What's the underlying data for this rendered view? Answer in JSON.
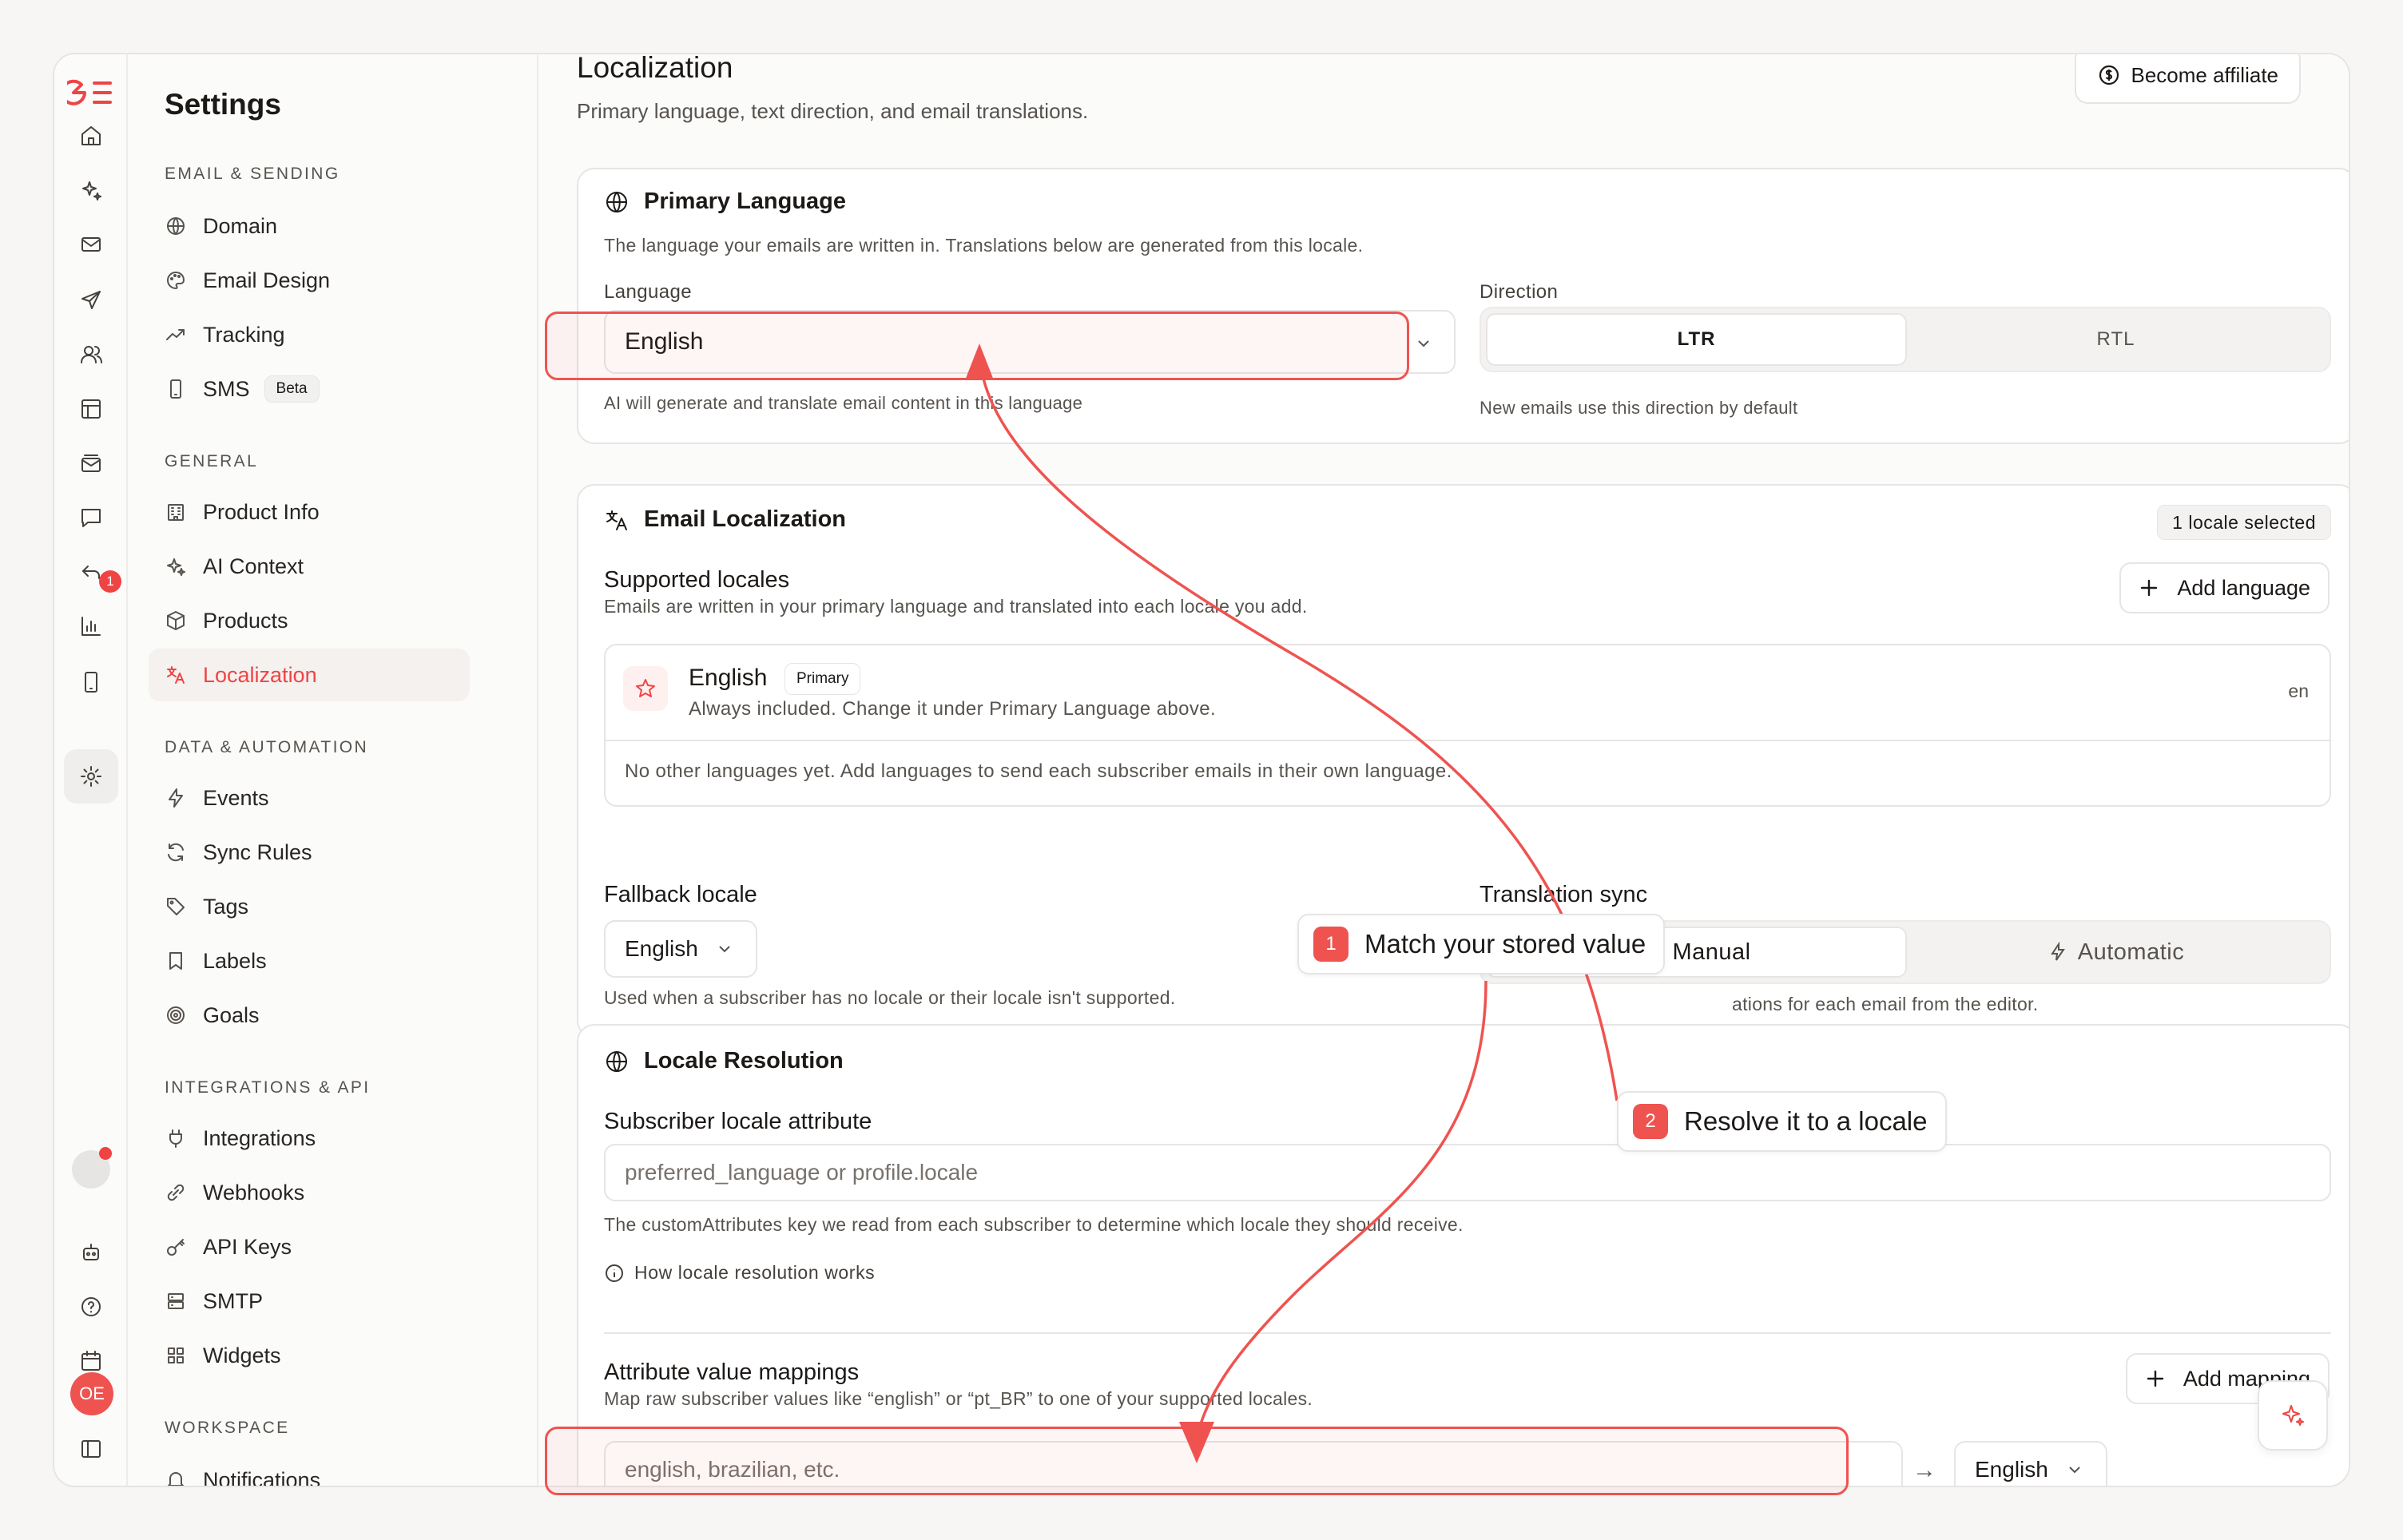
{
  "nav": {
    "title": "Settings",
    "sections": [
      {
        "label": "EMAIL & SENDING",
        "items": [
          {
            "label": "Domain",
            "icon": "globe-icon"
          },
          {
            "label": "Email Design",
            "icon": "palette-icon"
          },
          {
            "label": "Tracking",
            "icon": "trending-icon"
          },
          {
            "label": "SMS",
            "icon": "phone-icon",
            "badge": "Beta"
          }
        ]
      },
      {
        "label": "GENERAL",
        "items": [
          {
            "label": "Product Info",
            "icon": "building-icon"
          },
          {
            "label": "AI Context",
            "icon": "sparkles-icon"
          },
          {
            "label": "Products",
            "icon": "box-icon"
          },
          {
            "label": "Localization",
            "icon": "translate-icon",
            "active": true
          }
        ]
      },
      {
        "label": "DATA & AUTOMATION",
        "items": [
          {
            "label": "Events",
            "icon": "bolt-icon"
          },
          {
            "label": "Sync Rules",
            "icon": "refresh-icon"
          },
          {
            "label": "Tags",
            "icon": "tag-icon"
          },
          {
            "label": "Labels",
            "icon": "bookmark-icon"
          },
          {
            "label": "Goals",
            "icon": "target-icon"
          }
        ]
      },
      {
        "label": "INTEGRATIONS & API",
        "items": [
          {
            "label": "Integrations",
            "icon": "plug-icon"
          },
          {
            "label": "Webhooks",
            "icon": "link-icon"
          },
          {
            "label": "API Keys",
            "icon": "key-icon"
          },
          {
            "label": "SMTP",
            "icon": "server-icon"
          },
          {
            "label": "Widgets",
            "icon": "grid-icon"
          }
        ]
      },
      {
        "label": "WORKSPACE",
        "items": [
          {
            "label": "Notifications",
            "icon": "bell-icon"
          }
        ]
      }
    ]
  },
  "rail": {
    "notification_count": "1",
    "avatar_initials": "OE",
    "accent": "#ef4444"
  },
  "header": {
    "title": "Localization",
    "subtitle": "Primary language, text direction, and email translations.",
    "affiliate_label": "Become affiliate"
  },
  "primary_language": {
    "title": "Primary Language",
    "description": "The language your emails are written in. Translations below are generated from this locale.",
    "language_label": "Language",
    "language_value": "English",
    "language_help": "AI will generate and translate email content in this language",
    "direction_label": "Direction",
    "direction_options": [
      "LTR",
      "RTL"
    ],
    "direction_selected": "LTR",
    "direction_help": "New emails use this direction by default"
  },
  "email_localization": {
    "title": "Email Localization",
    "locale_count": "1 locale selected",
    "supported_title": "Supported locales",
    "supported_desc": "Emails are written in your primary language and translated into each locale you add.",
    "add_language": "Add language",
    "primary_locale": {
      "name": "English",
      "badge": "Primary",
      "desc": "Always included. Change it under Primary Language above.",
      "code": "en"
    },
    "empty_text": "No other languages yet. Add languages to send each subscriber emails in their own language.",
    "fallback_label": "Fallback locale",
    "fallback_value": "English",
    "fallback_help": "Used when a subscriber has no locale or their locale isn't supported.",
    "sync_label": "Translation sync",
    "sync_options": [
      "Manual",
      "Automatic"
    ],
    "sync_selected": "Manual",
    "sync_help": "ations for each email from the editor."
  },
  "locale_resolution": {
    "title": "Locale Resolution",
    "attr_label": "Subscriber locale attribute",
    "attr_placeholder": "preferred_language or profile.locale",
    "attr_help": "The customAttributes key we read from each subscriber to determine which locale they should receive.",
    "how_link": "How locale resolution works",
    "mappings_title": "Attribute value mappings",
    "mappings_desc": "Map raw subscriber values like “english” or “pt_BR” to one of your supported locales.",
    "add_mapping": "Add mapping",
    "mapping_placeholder": "english, brazilian, etc.",
    "mapping_locale": "English"
  },
  "callouts": [
    {
      "num": "1",
      "text": "Match your stored value"
    },
    {
      "num": "2",
      "text": "Resolve it to a locale"
    }
  ]
}
